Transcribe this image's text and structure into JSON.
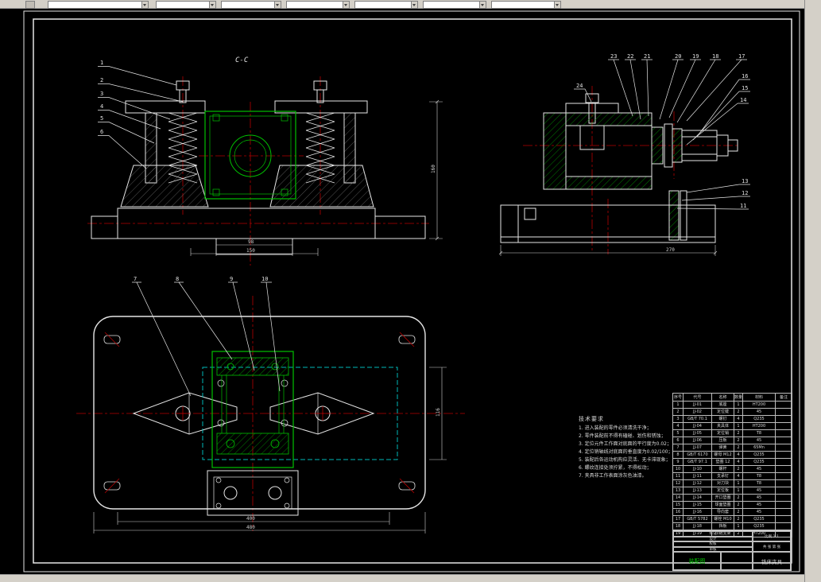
{
  "colors": {
    "line": "#e6e6e6",
    "green": "#00c000",
    "red": "#b40000",
    "cyan": "#00b8b8",
    "chrome": "#d4d0c8"
  },
  "sheet": {
    "view_cc": {
      "label": "C-C",
      "part_labels": [
        "1",
        "2",
        "3",
        "4",
        "5",
        "6"
      ],
      "dims": {
        "right": "160",
        "tongue": "98",
        "tongue2": "150"
      }
    },
    "view_side": {
      "labels_top": [
        "23",
        "22",
        "21",
        "20",
        "19",
        "18",
        "17"
      ],
      "labels_right_upper": [
        "16",
        "15",
        "14"
      ],
      "labels_right_lower": [
        "13",
        "12",
        "11"
      ],
      "label_24": "24",
      "dims": {
        "base": "270"
      }
    },
    "view_plan": {
      "part_labels": [
        "7",
        "8",
        "9",
        "10"
      ],
      "dims": {
        "width": "400",
        "width_total": "480",
        "height": "116"
      }
    }
  },
  "notes": {
    "title": "技术要求",
    "lines": [
      "1. 进入装配的零件必须清洗干净；",
      "2. 零件装配前不得有磕碰、划伤和锈蚀；",
      "3. 定位元件工作面对底面的平行度为0.02；",
      "4. 定位销轴线对底面的垂直度为0.02/100；",
      "5. 装配后各运动机构应灵活、无卡滞现象；",
      "6. 螺纹连接处须拧紧，不得松动；",
      "7. 夹具非工作表面涂灰色油漆。"
    ]
  },
  "parts_table": {
    "headers": [
      "序号",
      "代号",
      "名称",
      "数量",
      "材料",
      "备注"
    ],
    "rows": [
      {
        "no": "1",
        "code": "JJ-01",
        "name": "底座",
        "qty": "1",
        "material": "HT200",
        "note": ""
      },
      {
        "no": "2",
        "code": "JJ-02",
        "name": "定位键",
        "qty": "2",
        "material": "45",
        "note": ""
      },
      {
        "no": "3",
        "code": "GB/T 70.1",
        "name": "螺钉",
        "qty": "4",
        "material": "Q235",
        "note": ""
      },
      {
        "no": "4",
        "code": "JJ-04",
        "name": "夹具体",
        "qty": "1",
        "material": "HT200",
        "note": ""
      },
      {
        "no": "5",
        "code": "JJ-05",
        "name": "定位销",
        "qty": "2",
        "material": "T8",
        "note": ""
      },
      {
        "no": "6",
        "code": "JJ-06",
        "name": "压板",
        "qty": "2",
        "material": "45",
        "note": ""
      },
      {
        "no": "7",
        "code": "JJ-07",
        "name": "弹簧",
        "qty": "2",
        "material": "65Mn",
        "note": ""
      },
      {
        "no": "8",
        "code": "GB/T 6170",
        "name": "螺母 M12",
        "qty": "4",
        "material": "Q235",
        "note": ""
      },
      {
        "no": "9",
        "code": "GB/T 97.1",
        "name": "垫圈 12",
        "qty": "4",
        "material": "Q235",
        "note": ""
      },
      {
        "no": "10",
        "code": "JJ-10",
        "name": "螺杆",
        "qty": "2",
        "material": "45",
        "note": ""
      },
      {
        "no": "11",
        "code": "JJ-11",
        "name": "支承钉",
        "qty": "4",
        "material": "T8",
        "note": ""
      },
      {
        "no": "12",
        "code": "JJ-12",
        "name": "对刀块",
        "qty": "1",
        "material": "T8",
        "note": ""
      },
      {
        "no": "13",
        "code": "JJ-13",
        "name": "定位板",
        "qty": "1",
        "material": "45",
        "note": ""
      },
      {
        "no": "14",
        "code": "JJ-14",
        "name": "开口垫圈",
        "qty": "2",
        "material": "45",
        "note": ""
      },
      {
        "no": "15",
        "code": "JJ-15",
        "name": "球面垫圈",
        "qty": "2",
        "material": "45",
        "note": ""
      },
      {
        "no": "16",
        "code": "JJ-16",
        "name": "导向套",
        "qty": "2",
        "material": "45",
        "note": ""
      },
      {
        "no": "17",
        "code": "GB/T 5782",
        "name": "螺栓 M10",
        "qty": "2",
        "material": "Q235",
        "note": ""
      },
      {
        "no": "18",
        "code": "JJ-18",
        "name": "挡板",
        "qty": "1",
        "material": "Q235",
        "note": ""
      },
      {
        "no": "19",
        "code": "JJ-19",
        "name": "铰链支架",
        "qty": "2",
        "material": "HT200",
        "note": ""
      }
    ]
  },
  "title_block": {
    "left_rows": [
      "标记",
      "设计",
      "校核",
      "审核"
    ],
    "scale": "比例 1:1",
    "sheets": "共 张 第 张",
    "doc_type": "装配图",
    "drawing_name": "铣床夹具"
  }
}
